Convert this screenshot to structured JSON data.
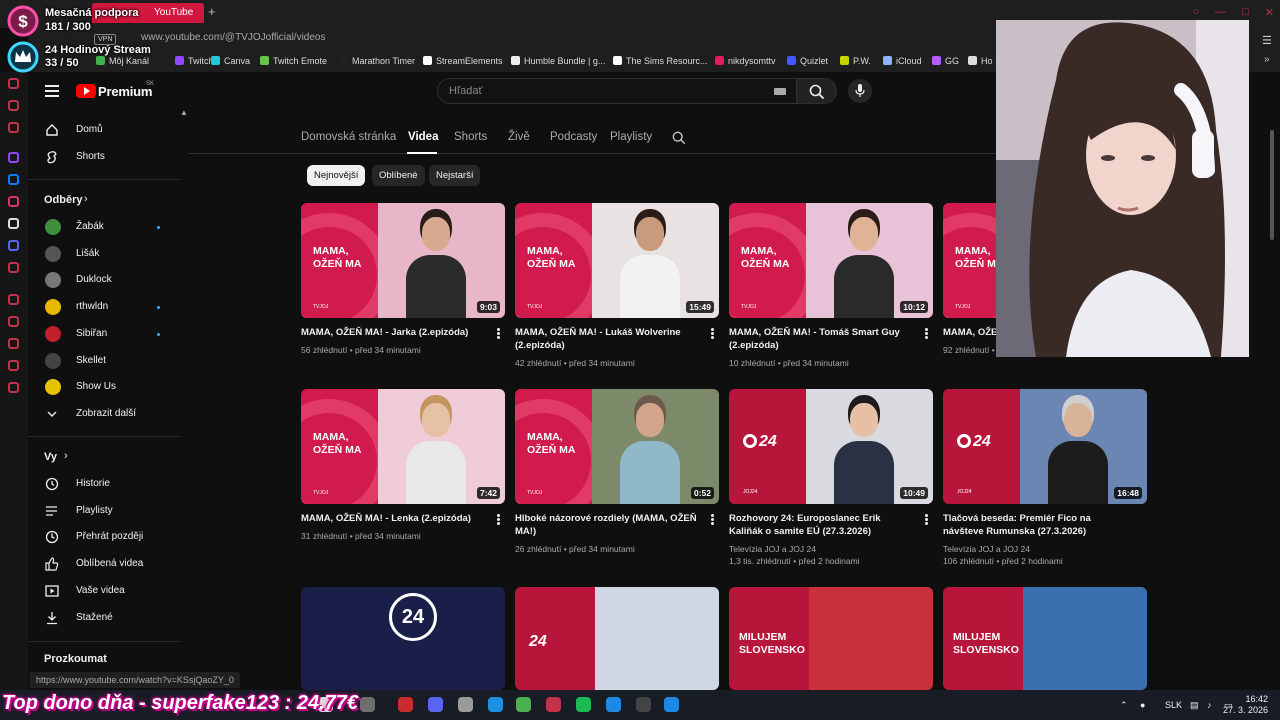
{
  "browser": {
    "tab_title": "YouTube",
    "url": "www.youtube.com/@TVJOJofficial/videos",
    "vpn_label": "VPN",
    "bookmarks": [
      {
        "label": "Marathon Timer",
        "color": "#222222"
      },
      {
        "label": "StreamElements",
        "color": "#ffffff"
      },
      {
        "label": "Humble Bundle | g...",
        "color": "#eeeeee"
      },
      {
        "label": "The Sims Resourc...",
        "color": "#ffffff"
      },
      {
        "label": "nikdysomttv",
        "color": "#e61b5c"
      },
      {
        "label": "Quizlet",
        "color": "#4255ff"
      },
      {
        "label": "P.W.",
        "color": "#c8d400"
      },
      {
        "label": "iCloud",
        "color": "#8fb3ff"
      },
      {
        "label": "GG",
        "color": "#b45cff"
      },
      {
        "label": "Ho",
        "color": "#dddddd"
      }
    ],
    "left_bookmarks": [
      {
        "label": "Môj Kanál",
        "color": "#3fb24f"
      },
      {
        "label": "Twitch",
        "color": "#9146ff"
      },
      {
        "label": "Canva",
        "color": "#26c6da"
      },
      {
        "label": "Twitch Emote",
        "color": "#6cc24a"
      }
    ]
  },
  "overlay": {
    "sub_goal_label": "Mesačná podpora",
    "sub_goal_value": "181 / 300",
    "stream_label": "24 Hodinový Stream",
    "stream_value": "33 / 50",
    "top_donor": "Top dono dňa - superfake123 : 24.77€",
    "status_url": "https://www.youtube.com/watch?v=KSsjQaoZY_0"
  },
  "masthead": {
    "logo_text": "Premium",
    "region": "SK",
    "search_placeholder": "Hľadať"
  },
  "sidebar": {
    "main": [
      {
        "label": "Domů",
        "icon": "home-icon"
      },
      {
        "label": "Shorts",
        "icon": "shorts-icon"
      }
    ],
    "subs_header": "Odběry",
    "subscriptions": [
      {
        "label": "Žabák",
        "color": "#3d8f3a",
        "dot": true
      },
      {
        "label": "Lišák",
        "color": "#555555",
        "dot": false
      },
      {
        "label": "Duklock",
        "color": "#777777",
        "dot": false
      },
      {
        "label": "rthwldn",
        "color": "#e6b800",
        "dot": true
      },
      {
        "label": "Sibiřan",
        "color": "#c0202a",
        "dot": true
      },
      {
        "label": "Skellet",
        "color": "#444444",
        "dot": false
      },
      {
        "label": "Show Us",
        "color": "#e6c200",
        "dot": false
      }
    ],
    "show_more": "Zobrazit další",
    "you_header": "Vy",
    "you": [
      {
        "label": "Historie",
        "icon": "history-icon"
      },
      {
        "label": "Playlisty",
        "icon": "playlist-icon"
      },
      {
        "label": "Přehrát později",
        "icon": "watch-later-icon"
      },
      {
        "label": "Oblíbená videa",
        "icon": "like-icon"
      },
      {
        "label": "Vaše videa",
        "icon": "your-videos-icon"
      },
      {
        "label": "Stažené",
        "icon": "download-icon"
      }
    ],
    "explore_header": "Prozkoumat"
  },
  "channel_tabs": [
    "Domovská stránka",
    "Videa",
    "Shorts",
    "Živě",
    "Podcasty",
    "Playlisty"
  ],
  "active_tab": "Videa",
  "chips": [
    "Nejnovější",
    "Oblíbené",
    "Nejstarší"
  ],
  "videos": [
    {
      "title": "MAMA, OŽEŇ MA! - Jarka (2.epizóda)",
      "views": "56 zhlédnutí",
      "time": "před 34 minutami",
      "duration": "9:03",
      "kind": "show",
      "channel": ""
    },
    {
      "title": "MAMA, OŽEŇ MA! - Lukáš Wolverine (2.epizóda)",
      "views": "42 zhlédnutí",
      "time": "před 34 minutami",
      "duration": "15:49",
      "kind": "show",
      "channel": ""
    },
    {
      "title": "MAMA, OŽEŇ MA! - Tomáš Smart Guy (2.epizóda)",
      "views": "10 zhlédnutí",
      "time": "před 34 minutami",
      "duration": "10:12",
      "kind": "show",
      "channel": ""
    },
    {
      "title": "MAMA, OŽE",
      "views": "92 zhlédnutí",
      "time": "p",
      "duration": "",
      "kind": "show",
      "channel": ""
    },
    {
      "title": "MAMA, OŽEŇ MA! - Lenka (2.epizóda)",
      "views": "31 zhlédnutí",
      "time": "před 34 minutami",
      "duration": "7:42",
      "kind": "show",
      "channel": ""
    },
    {
      "title": "Hlboké názorové rozdiely (MAMA, OŽEŇ MA!)",
      "views": "26 zhlédnutí",
      "time": "před 34 minutami",
      "duration": "0:52",
      "kind": "show",
      "channel": ""
    },
    {
      "title": "Rozhovory 24: Europoslanec Erik Kaliňák o samite EÚ (27.3.2026)",
      "views": "1,3 tis. zhlédnutí",
      "time": "před 2 hodinami",
      "duration": "10:49",
      "kind": "news",
      "channel": "Televízia JOJ a JOJ 24"
    },
    {
      "title": "Tlačová beseda: Premiér Fico na návšteve Rumunska (27.3.2026)",
      "views": "106 zhlédnutí",
      "time": "před 2 hodinami",
      "duration": "16:48",
      "kind": "news",
      "channel": "Televízia JOJ a JOJ 24"
    }
  ],
  "row3_labels": [
    "24",
    "24",
    "MILUJEM SLOVENSKO",
    "MILUJEM SLOVENSKO"
  ],
  "thumb_brand": "MAMA, OŽEŇ MA",
  "thumb_logo": "TVJOJ",
  "news_logo": "24",
  "news_logo_small": "JOJ24",
  "taskbar": {
    "lang": "SLK",
    "time": "16:42",
    "date": "27. 3. 2026"
  }
}
